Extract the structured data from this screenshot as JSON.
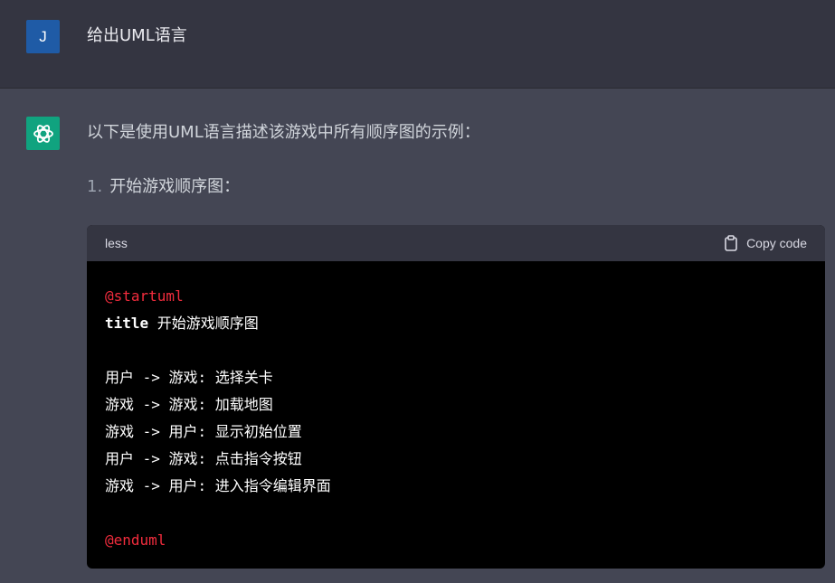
{
  "user": {
    "avatar_letter": "J",
    "message": "给出UML语言"
  },
  "assistant": {
    "intro": "以下是使用UML语言描述该游戏中所有顺序图的示例：",
    "list": [
      {
        "number": "1.",
        "text": "开始游戏顺序图："
      }
    ],
    "code_block": {
      "language": "less",
      "copy_label": "Copy code",
      "lines": {
        "l1": "@startuml",
        "l2_kw": "title",
        "l2_rest": " 开始游戏顺序图",
        "l3": "",
        "l4": "用户 -> 游戏: 选择关卡",
        "l5": "游戏 -> 游戏: 加载地图",
        "l6": "游戏 -> 用户: 显示初始位置",
        "l7": "用户 -> 游戏: 点击指令按钮",
        "l8": "游戏 -> 用户: 进入指令编辑界面",
        "l9": "",
        "l10": "@enduml"
      }
    }
  },
  "colors": {
    "user_bg": "#343541",
    "assistant_bg": "#444654",
    "user_avatar": "#1f5ba6",
    "assistant_avatar": "#10a37f",
    "code_bg": "#000000",
    "code_header_bg": "#343541",
    "directive": "#f22c3d"
  },
  "icons": {
    "assistant_avatar": "openai-logo-icon",
    "copy": "clipboard-icon"
  }
}
